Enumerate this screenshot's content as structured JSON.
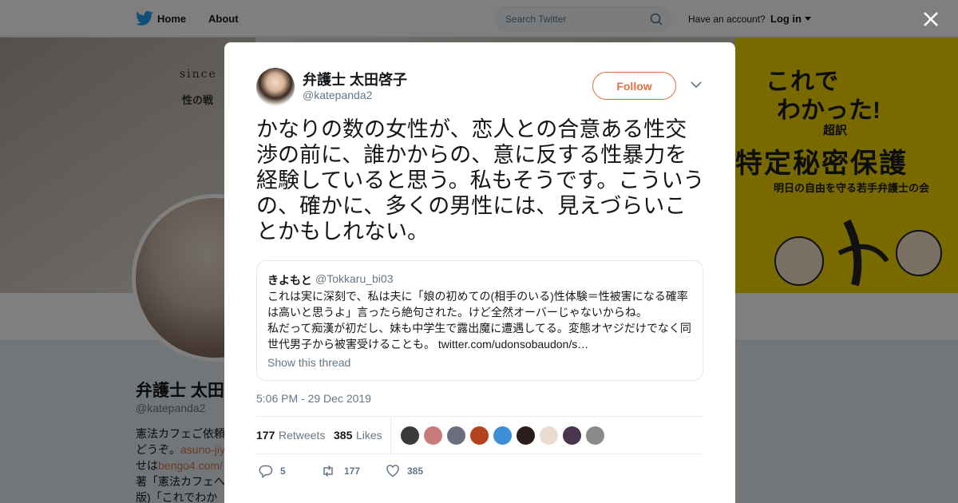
{
  "nav": {
    "home": "Home",
    "about": "About",
    "search_placeholder": "Search Twitter",
    "have_account": "Have an account?",
    "login": "Log in"
  },
  "banner": {
    "since": "since",
    "line": "性の戦",
    "book_lines": [
      "これで",
      "わかった!",
      "超訳",
      "特定秘密保護",
      "明日の自由を守る若手弁護士の会"
    ]
  },
  "profile": {
    "name": "弁護士 太田",
    "handle": "@katepanda2",
    "bio_lines": [
      {
        "text": "憲法カフェご依頼",
        "link": ""
      },
      {
        "text": "どうぞ。",
        "link": "asuno-jiy"
      },
      {
        "text": "せは",
        "link": "bengo4.com/"
      },
      {
        "text": "著「憲法カフェへ",
        "link": ""
      },
      {
        "text": "版)「これでわかっ",
        "link": ""
      }
    ]
  },
  "tweet": {
    "author_name": "弁護士 太田啓子",
    "author_handle": "@katepanda2",
    "follow_label": "Follow",
    "text": "かなりの数の女性が、恋人との合意ある性交渉の前に、誰かからの、意に反する性暴力を経験していると思う。私もそうです。こういうの、確かに、多くの男性には、見えづらいことかもしれない。",
    "quoted": {
      "name": "きよもと",
      "handle": "@Tokkaru_bi03",
      "body": "これは実に深刻で、私は夫に「娘の初めての(相手のいる)性体験＝性被害になる確率は高いと思うよ」言ったら絶句された。けど全然オーバーじゃないからね。\n私だって痴漢が初だし、妹も中学生で露出魔に遭遇してる。変態オヤジだけでなく同世代男子から被害受けることも。 twitter.com/udonsobaudon/s…",
      "show_thread": "Show this thread"
    },
    "timestamp": "5:06 PM - 29 Dec 2019",
    "retweets_count": "177",
    "retweets_label": "Retweets",
    "likes_count": "385",
    "likes_label": "Likes",
    "liker_colors": [
      "#3a3a3a",
      "#c77b7b",
      "#6a6f80",
      "#b5421e",
      "#3b8fd6",
      "#2a1e1a",
      "#e8ddd0",
      "#4a3550",
      "#8a8a8a"
    ],
    "actions": {
      "reply_count": "5",
      "retweet_count": "177",
      "like_count": "385"
    }
  },
  "colors": {
    "accent": "#e0703e",
    "twitter_blue": "#1da1f2",
    "muted": "#657786"
  }
}
